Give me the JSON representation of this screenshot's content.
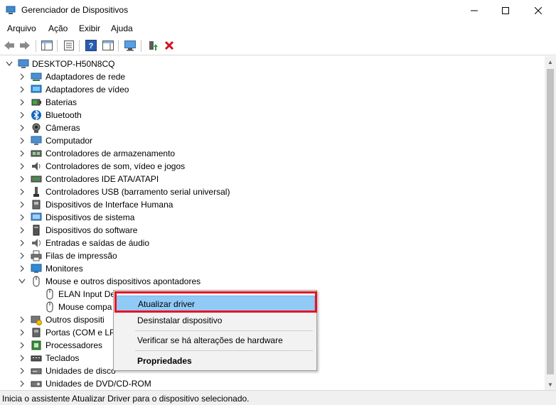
{
  "window": {
    "title": "Gerenciador de Dispositivos",
    "controls": [
      "—",
      "☐",
      "✕"
    ]
  },
  "menu": [
    "Arquivo",
    "Ação",
    "Exibir",
    "Ajuda"
  ],
  "tree": {
    "root": "DESKTOP-H50N8CQ",
    "categories": [
      "Adaptadores de rede",
      "Adaptadores de vídeo",
      "Baterias",
      "Bluetooth",
      "Câmeras",
      "Computador",
      "Controladores de armazenamento",
      "Controladores de som, vídeo e jogos",
      "Controladores IDE ATA/ATAPI",
      "Controladores USB (barramento serial universal)",
      "Dispositivos de Interface Humana",
      "Dispositivos de sistema",
      "Dispositivos do software",
      "Entradas e saídas de áudio",
      "Filas de impressão",
      "Monitores",
      "Mouse e outros dispositivos apontadores"
    ],
    "mouse_children": [
      "ELAN Input De",
      "Mouse compa"
    ],
    "after": [
      "Outros dispositi",
      "Portas (COM e LP",
      "Processadores",
      "Teclados",
      "Unidades de disco",
      "Unidades de DVD/CD-ROM"
    ]
  },
  "context_menu": {
    "update": "Atualizar driver",
    "uninstall": "Desinstalar dispositivo",
    "scan": "Verificar se há alterações de hardware",
    "properties": "Propriedades"
  },
  "status": "Inicia o assistente Atualizar Driver para o dispositivo selecionado.",
  "colors": {
    "highlight": "#91c9f7",
    "red_outline": "#e81123"
  }
}
